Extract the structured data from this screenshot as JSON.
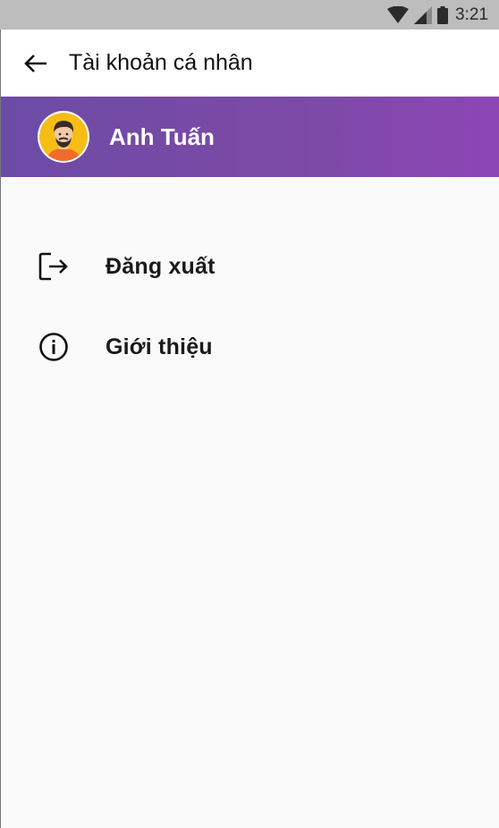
{
  "status_bar": {
    "time": "3:21",
    "icons": [
      "wifi-icon",
      "signal-icon",
      "battery-icon"
    ]
  },
  "app_bar": {
    "title": "Tài khoản cá nhân",
    "back_icon": "arrow-left-icon"
  },
  "profile": {
    "name": "Anh Tuấn",
    "avatar_icon": "user-avatar-icon",
    "banner_colors": [
      "#6c4ba6",
      "#8d46b6"
    ]
  },
  "menu": {
    "items": [
      {
        "label": "Đăng xuất",
        "icon": "logout-icon"
      },
      {
        "label": "Giới thiệu",
        "icon": "info-icon"
      }
    ]
  }
}
